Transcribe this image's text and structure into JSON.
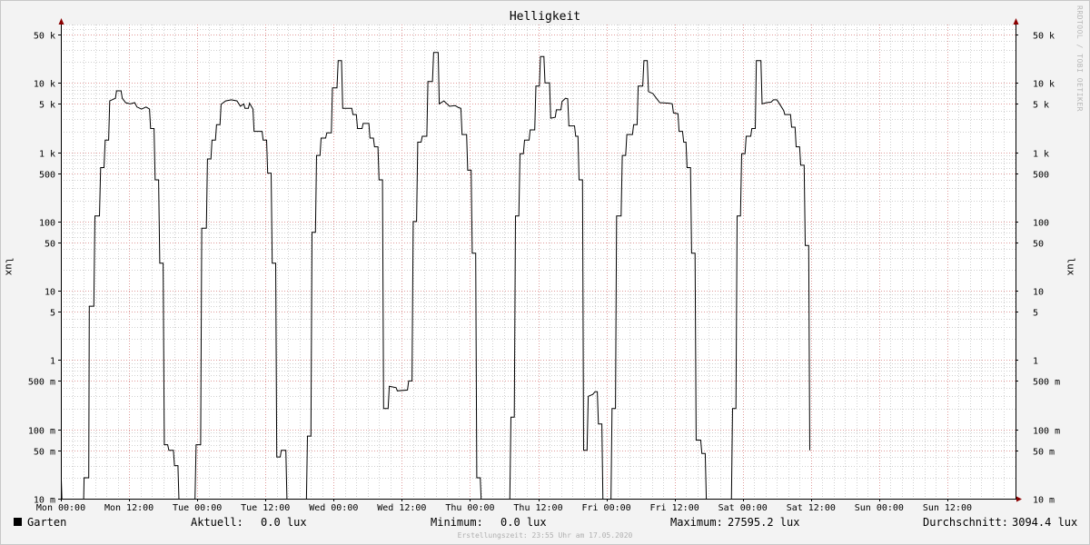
{
  "chart_data": {
    "type": "line",
    "title": "Helligkeit",
    "ylabel": "lux",
    "yscale": "log",
    "ylim": [
      0.01,
      100000
    ],
    "xlim": [
      0,
      168
    ],
    "yticks": [
      {
        "v": 0.01,
        "label": "10 m"
      },
      {
        "v": 0.05,
        "label": "50 m"
      },
      {
        "v": 0.1,
        "label": "100 m"
      },
      {
        "v": 0.5,
        "label": "500 m"
      },
      {
        "v": 1,
        "label": "1"
      },
      {
        "v": 5,
        "label": "5"
      },
      {
        "v": 10,
        "label": "10"
      },
      {
        "v": 50,
        "label": "50"
      },
      {
        "v": 100,
        "label": "100"
      },
      {
        "v": 500,
        "label": "500"
      },
      {
        "v": 1000,
        "label": "1 k"
      },
      {
        "v": 5000,
        "label": "5 k"
      },
      {
        "v": 10000,
        "label": "10 k"
      },
      {
        "v": 50000,
        "label": "50 k"
      }
    ],
    "xticks": [
      {
        "h": 0,
        "label": "Mon 00:00"
      },
      {
        "h": 12,
        "label": "Mon 12:00"
      },
      {
        "h": 24,
        "label": "Tue 00:00"
      },
      {
        "h": 36,
        "label": "Tue 12:00"
      },
      {
        "h": 48,
        "label": "Wed 00:00"
      },
      {
        "h": 60,
        "label": "Wed 12:00"
      },
      {
        "h": 72,
        "label": "Thu 00:00"
      },
      {
        "h": 84,
        "label": "Thu 12:00"
      },
      {
        "h": 96,
        "label": "Fri 00:00"
      },
      {
        "h": 108,
        "label": "Fri 12:00"
      },
      {
        "h": 120,
        "label": "Sat 00:00"
      },
      {
        "h": 132,
        "label": "Sat 12:00"
      },
      {
        "h": 144,
        "label": "Sun 00:00"
      },
      {
        "h": 156,
        "label": "Sun 12:00"
      }
    ],
    "grid": true,
    "series": [
      {
        "name": "Garten",
        "color": "#000000",
        "points": [
          [
            0,
            0.03
          ],
          [
            0.2,
            0.005
          ],
          [
            4,
            0.005
          ],
          [
            4.1,
            0.02
          ],
          [
            4.9,
            0.02
          ],
          [
            5.0,
            6
          ],
          [
            5.8,
            6
          ],
          [
            6.0,
            120
          ],
          [
            6.8,
            120
          ],
          [
            7.0,
            600
          ],
          [
            7.6,
            600
          ],
          [
            7.8,
            1500
          ],
          [
            8.4,
            1500
          ],
          [
            8.6,
            5500
          ],
          [
            9.6,
            6000
          ],
          [
            9.8,
            7700
          ],
          [
            10.6,
            7700
          ],
          [
            10.8,
            6000
          ],
          [
            11.4,
            5200
          ],
          [
            12.2,
            5000
          ],
          [
            13.0,
            5200
          ],
          [
            13.4,
            4500
          ],
          [
            14.2,
            4200
          ],
          [
            15.0,
            4500
          ],
          [
            15.6,
            4200
          ],
          [
            15.8,
            2200
          ],
          [
            16.4,
            2200
          ],
          [
            16.6,
            400
          ],
          [
            17.2,
            400
          ],
          [
            17.4,
            25
          ],
          [
            18.0,
            25
          ],
          [
            18.2,
            0.06
          ],
          [
            18.8,
            0.06
          ],
          [
            19.0,
            0.05
          ],
          [
            19.8,
            0.05
          ],
          [
            20.0,
            0.03
          ],
          [
            20.6,
            0.03
          ],
          [
            20.8,
            0.005
          ],
          [
            23.6,
            0.005
          ],
          [
            23.8,
            0.06
          ],
          [
            24.6,
            0.06
          ],
          [
            24.8,
            80
          ],
          [
            25.6,
            80
          ],
          [
            25.8,
            800
          ],
          [
            26.4,
            800
          ],
          [
            26.6,
            1500
          ],
          [
            27.2,
            1500
          ],
          [
            27.4,
            2500
          ],
          [
            28.0,
            2500
          ],
          [
            28.2,
            4900
          ],
          [
            29.0,
            5500
          ],
          [
            30.0,
            5700
          ],
          [
            31.0,
            5500
          ],
          [
            31.6,
            4600
          ],
          [
            32.2,
            5000
          ],
          [
            32.4,
            4300
          ],
          [
            33.0,
            4300
          ],
          [
            33.2,
            5100
          ],
          [
            33.8,
            4200
          ],
          [
            34.0,
            2000
          ],
          [
            35.4,
            2000
          ],
          [
            35.6,
            1500
          ],
          [
            36.2,
            1500
          ],
          [
            36.4,
            500
          ],
          [
            37.0,
            500
          ],
          [
            37.2,
            25
          ],
          [
            37.8,
            25
          ],
          [
            38.0,
            0.04
          ],
          [
            38.6,
            0.04
          ],
          [
            38.8,
            0.05
          ],
          [
            39.6,
            0.05
          ],
          [
            39.8,
            0.005
          ],
          [
            43.2,
            0.005
          ],
          [
            43.4,
            0.08
          ],
          [
            44.0,
            0.08
          ],
          [
            44.2,
            70
          ],
          [
            44.8,
            70
          ],
          [
            45.0,
            900
          ],
          [
            45.6,
            900
          ],
          [
            45.8,
            1600
          ],
          [
            46.6,
            1600
          ],
          [
            46.8,
            1900
          ],
          [
            47.6,
            1900
          ],
          [
            47.8,
            8500
          ],
          [
            48.6,
            8500
          ],
          [
            48.8,
            21000
          ],
          [
            49.4,
            21000
          ],
          [
            49.6,
            4300
          ],
          [
            51.2,
            4300
          ],
          [
            51.4,
            3500
          ],
          [
            52.0,
            3500
          ],
          [
            52.2,
            2200
          ],
          [
            53.0,
            2200
          ],
          [
            53.2,
            2600
          ],
          [
            54.2,
            2600
          ],
          [
            54.4,
            1600
          ],
          [
            55.0,
            1600
          ],
          [
            55.2,
            1200
          ],
          [
            55.8,
            1200
          ],
          [
            56.0,
            400
          ],
          [
            56.6,
            400
          ],
          [
            56.8,
            0.2
          ],
          [
            57.6,
            0.2
          ],
          [
            57.8,
            0.42
          ],
          [
            59.0,
            0.4
          ],
          [
            59.2,
            0.36
          ],
          [
            61.0,
            0.37
          ],
          [
            61.2,
            0.5
          ],
          [
            61.8,
            0.5
          ],
          [
            62.0,
            100
          ],
          [
            62.6,
            100
          ],
          [
            62.8,
            1400
          ],
          [
            63.4,
            1400
          ],
          [
            63.6,
            1700
          ],
          [
            64.4,
            1700
          ],
          [
            64.6,
            10500
          ],
          [
            65.4,
            10500
          ],
          [
            65.6,
            27500
          ],
          [
            66.4,
            27500
          ],
          [
            66.6,
            5000
          ],
          [
            67.4,
            5500
          ],
          [
            68.4,
            4600
          ],
          [
            69.4,
            4700
          ],
          [
            70.0,
            4400
          ],
          [
            70.4,
            4300
          ],
          [
            70.6,
            1800
          ],
          [
            71.4,
            1800
          ],
          [
            71.6,
            550
          ],
          [
            72.2,
            550
          ],
          [
            72.4,
            35
          ],
          [
            73.0,
            35
          ],
          [
            73.2,
            0.02
          ],
          [
            73.8,
            0.02
          ],
          [
            74.0,
            0.005
          ],
          [
            79.0,
            0.005
          ],
          [
            79.2,
            0.15
          ],
          [
            79.8,
            0.15
          ],
          [
            80.0,
            120
          ],
          [
            80.6,
            120
          ],
          [
            80.8,
            950
          ],
          [
            81.4,
            950
          ],
          [
            81.6,
            1500
          ],
          [
            82.4,
            1500
          ],
          [
            82.6,
            2100
          ],
          [
            83.4,
            2100
          ],
          [
            83.6,
            9000
          ],
          [
            84.2,
            9000
          ],
          [
            84.4,
            24000
          ],
          [
            85.0,
            24000
          ],
          [
            85.2,
            10000
          ],
          [
            86.0,
            10000
          ],
          [
            86.2,
            3100
          ],
          [
            87.0,
            3200
          ],
          [
            87.2,
            4100
          ],
          [
            88.0,
            4100
          ],
          [
            88.2,
            5400
          ],
          [
            88.8,
            6000
          ],
          [
            89.2,
            5900
          ],
          [
            89.4,
            2400
          ],
          [
            90.4,
            2400
          ],
          [
            90.6,
            1700
          ],
          [
            91.0,
            1700
          ],
          [
            91.2,
            400
          ],
          [
            91.8,
            400
          ],
          [
            92.0,
            0.05
          ],
          [
            92.6,
            0.05
          ],
          [
            92.8,
            0.3
          ],
          [
            93.6,
            0.32
          ],
          [
            94.0,
            0.35
          ],
          [
            94.4,
            0.35
          ],
          [
            94.6,
            0.12
          ],
          [
            95.2,
            0.12
          ],
          [
            95.4,
            0.005
          ],
          [
            96.8,
            0.005
          ],
          [
            97.0,
            0.2
          ],
          [
            97.6,
            0.2
          ],
          [
            97.8,
            120
          ],
          [
            98.6,
            120
          ],
          [
            98.8,
            900
          ],
          [
            99.4,
            900
          ],
          [
            99.6,
            1800
          ],
          [
            100.6,
            1800
          ],
          [
            100.8,
            2500
          ],
          [
            101.4,
            2500
          ],
          [
            101.6,
            9000
          ],
          [
            102.4,
            9000
          ],
          [
            102.6,
            21000
          ],
          [
            103.2,
            21000
          ],
          [
            103.4,
            7500
          ],
          [
            104.2,
            7000
          ],
          [
            104.8,
            6000
          ],
          [
            105.4,
            5200
          ],
          [
            107.0,
            5100
          ],
          [
            107.6,
            5000
          ],
          [
            107.8,
            3700
          ],
          [
            108.6,
            3600
          ],
          [
            108.8,
            2000
          ],
          [
            109.4,
            2000
          ],
          [
            109.6,
            1400
          ],
          [
            110.0,
            1400
          ],
          [
            110.2,
            600
          ],
          [
            110.8,
            600
          ],
          [
            111.0,
            35
          ],
          [
            111.6,
            35
          ],
          [
            111.8,
            0.07
          ],
          [
            112.6,
            0.07
          ],
          [
            112.8,
            0.045
          ],
          [
            113.4,
            0.045
          ],
          [
            113.6,
            0.005
          ],
          [
            118.0,
            0.005
          ],
          [
            118.2,
            0.2
          ],
          [
            118.8,
            0.2
          ],
          [
            119.0,
            120
          ],
          [
            119.6,
            120
          ],
          [
            119.8,
            950
          ],
          [
            120.4,
            950
          ],
          [
            120.6,
            1700
          ],
          [
            121.4,
            1700
          ],
          [
            121.6,
            2200
          ],
          [
            122.2,
            2200
          ],
          [
            122.4,
            21000
          ],
          [
            123.2,
            21000
          ],
          [
            123.4,
            5000
          ],
          [
            124.2,
            5200
          ],
          [
            125.0,
            5300
          ],
          [
            125.4,
            5700
          ],
          [
            126.0,
            5700
          ],
          [
            126.2,
            5400
          ],
          [
            127.2,
            4000
          ],
          [
            127.4,
            3500
          ],
          [
            128.4,
            3500
          ],
          [
            128.6,
            2300
          ],
          [
            129.2,
            2300
          ],
          [
            129.4,
            1200
          ],
          [
            130.0,
            1200
          ],
          [
            130.2,
            650
          ],
          [
            130.8,
            650
          ],
          [
            131.0,
            45
          ],
          [
            131.6,
            45
          ],
          [
            131.8,
            0.05
          ]
        ]
      }
    ]
  },
  "title": "Helligkeit",
  "ylabel_left": "lux",
  "ylabel_right": "lux",
  "watermark": "RRDTOOL / TOBI OETIKER",
  "legend": {
    "name": "Garten",
    "current_label": "Aktuell:",
    "current_value": "0.0 lux",
    "min_label": "Minimum:",
    "min_value": "0.0 lux",
    "max_label": "Maximum:",
    "max_value": "27595.2 lux",
    "avg_label": "Durchschnitt:",
    "avg_value": "3094.4 lux"
  },
  "footer": "Erstellungszeit: 23:55 Uhr am 17.05.2020"
}
